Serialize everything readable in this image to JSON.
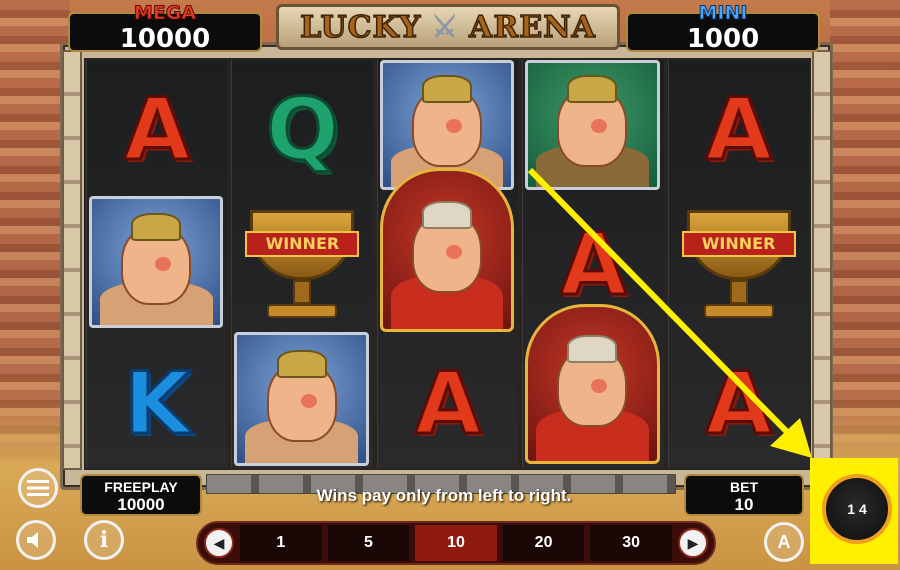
{
  "header": {
    "logo_word1": "LUCKY",
    "logo_word2": "ARENA",
    "mega": {
      "label": "MEGA",
      "value": "10000"
    },
    "mini": {
      "label": "MINI",
      "value": "1000"
    }
  },
  "reels": {
    "symbols": {
      "letter_A": "A",
      "letter_Q": "Q",
      "letter_K": "K",
      "trophy": "WINNER"
    }
  },
  "footer": {
    "freeplay": {
      "label": "FREEPLAY",
      "value": "10000"
    },
    "bet": {
      "label": "BET",
      "value": "10"
    },
    "message": "Wins pay only from left to right.",
    "bet_options": [
      "1",
      "5",
      "10",
      "20",
      "30"
    ],
    "selected_bet": "10",
    "auto_label": "A",
    "spin_label": "1 4",
    "info_label": "i"
  },
  "colors": {
    "highlight": "#ffef00",
    "arrow": "#ffef00",
    "mega": "#e83a2a",
    "mini": "#4aa8ff"
  }
}
